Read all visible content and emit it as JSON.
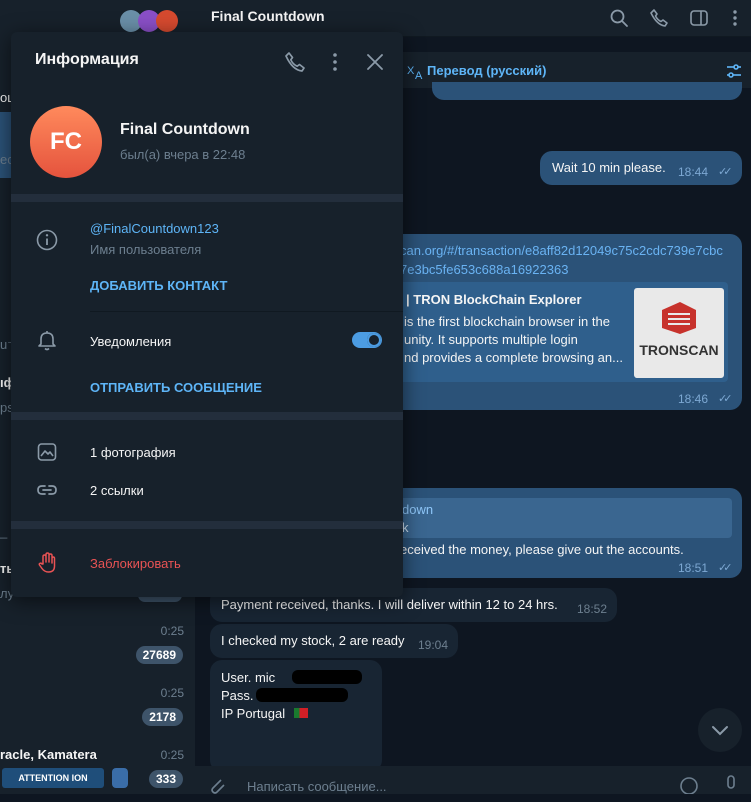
{
  "chat": {
    "title": "Final Countdown",
    "translate_label": "Перевод (русский)",
    "composer_placeholder": "Написать сообщение...",
    "messages": {
      "m1_text": "Wait 10 min please.",
      "m1_time": "18:44",
      "link_text_1": "can.org/#/transaction/e8aff82d12049c75c2cdc739e7cbc",
      "link_text_2": "7e3bc5fe653c688a16922363",
      "preview_title": "| TRON BlockChain Explorer",
      "preview_line_1": "is the first blockchain browser in the",
      "preview_line_2": "unity. It supports multiple login",
      "preview_line_3": "nd provides a complete browsing an...",
      "preview_logo": "TRONSCAN",
      "m2_time": "18:46",
      "reply_name": "down",
      "reply_text": "k",
      "m3_text": "eceived the money, please give out the accounts.",
      "m3_time": "18:51",
      "m4_text": "Payment received, thanks. I will deliver within 12 to 24 hrs.",
      "m4_time": "18:52",
      "m5_text": "I checked my stock, 2 are ready",
      "m5_time": "19:04",
      "m6_line1": "User.  mic",
      "m6_line2": "Pass. ",
      "m6_line3": "IP Portugal"
    }
  },
  "sidebar": {
    "frag_1": "ощ",
    "frag_2": "ec",
    "frag_3": "u⁻",
    "frag_4": "ıф",
    "frag_5": "ps",
    "frag_6": "_ |",
    "frag_7": "ть",
    "frag_8": "лу",
    "rows": [
      {
        "time": "0:25",
        "badge": "27689"
      },
      {
        "time": "0:25",
        "badge": "2178"
      },
      {
        "name": "racle, Kamatera",
        "time": "0:25",
        "badge": "333"
      }
    ],
    "banner": "ATTENTION ION"
  },
  "panel": {
    "title": "Информация",
    "avatar_initials": "FC",
    "name": "Final Countdown",
    "status": "был(а) вчера в 22:48",
    "username": "@FinalCountdown123",
    "username_caption": "Имя пользователя",
    "add_contact": "ДОБАВИТЬ КОНТАКТ",
    "notifications": "Уведомления",
    "notifications_enabled": true,
    "send_message": "ОТПРАВИТЬ СООБЩЕНИЕ",
    "photos": "1 фотография",
    "links": "2 ссылки",
    "block": "Заблокировать"
  },
  "colors": {
    "accent": "#5eb5f7",
    "danger": "#e85354",
    "panel": "#17212b",
    "bg": "#0e1621"
  }
}
